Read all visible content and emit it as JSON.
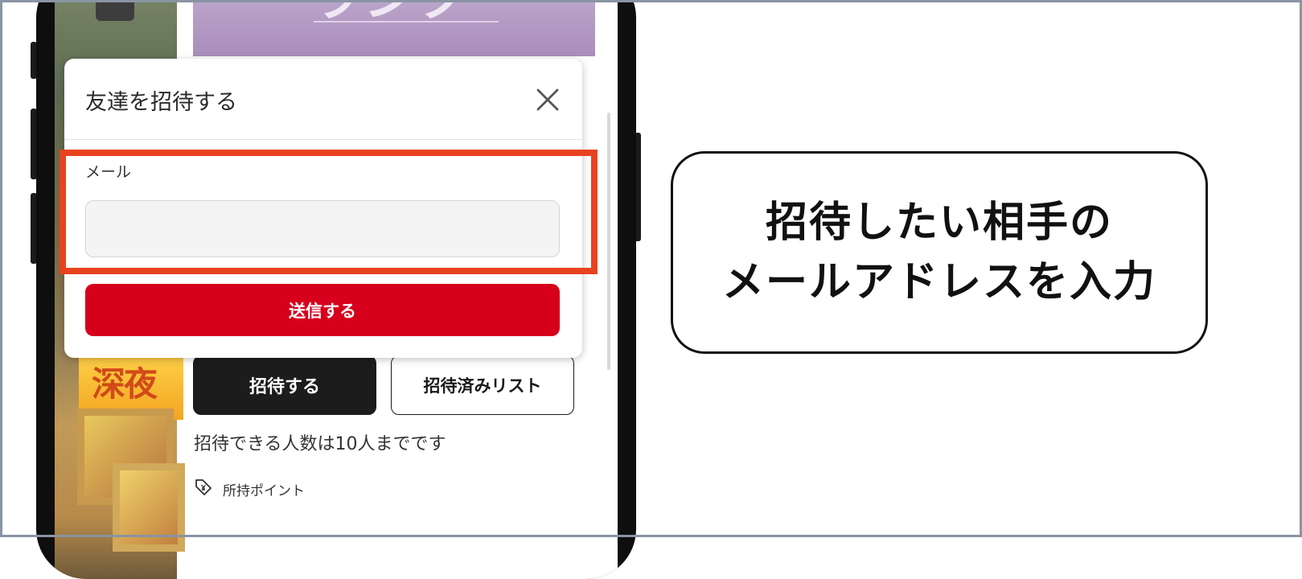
{
  "page": {
    "banner_text": "ランク",
    "strip_banner_text": "深夜"
  },
  "dialog": {
    "title": "友達を招待する",
    "email_label": "メール",
    "email_value": "",
    "email_placeholder": "",
    "send_button": "送信する",
    "close_icon": "close-icon"
  },
  "page_actions": {
    "invite_button": "招待する",
    "invited_list_button": "招待済みリスト",
    "limit_note": "招待できる人数は10人までです",
    "points_label": "所持ポイント",
    "points_icon": "tag-yen-icon"
  },
  "callout": {
    "line1": "招待したい相手の",
    "line2": "メールアドレスを入力"
  },
  "colors": {
    "highlight": "#e8431f",
    "send_button": "#d6001c",
    "invite_button": "#1c1c1c"
  }
}
